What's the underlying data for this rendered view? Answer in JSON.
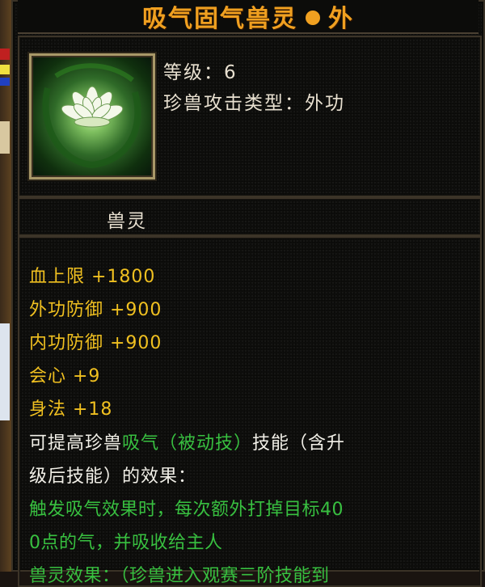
{
  "title": {
    "name": "吸气固气兽灵",
    "type": "外"
  },
  "info": {
    "level_label": "等级：6",
    "attack_type_label": "珍兽攻击类型：外功"
  },
  "item_category": "兽灵",
  "stats": [
    "血上限 +1800",
    "外功防御 +900",
    "内功防御 +900",
    "会心 +9",
    "身法 +18"
  ],
  "description": {
    "line1_prefix": "可提高珍兽",
    "line1_skill": "吸气（被动技）",
    "line1_suffix": "技能（含升",
    "line2": "级后技能）的效果："
  },
  "effect_lines": [
    "触发吸气效果时，每次额外打掉目标40",
    "0点的气，并吸收给主人",
    "兽灵效果：（珍兽进入观赛三阶技能到"
  ],
  "colors": {
    "title": "#f0a020",
    "stat": "#f0c020",
    "text": "#e8e0d0",
    "effect": "#38c040",
    "frame": "#a89868"
  },
  "icon": "lotus-spirit-icon"
}
